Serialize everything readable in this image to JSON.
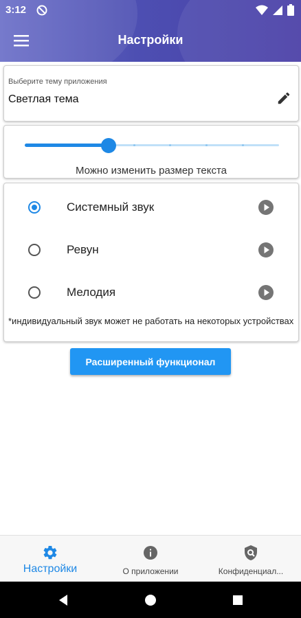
{
  "status_bar": {
    "time": "3:12"
  },
  "app_bar": {
    "title": "Настройки"
  },
  "theme": {
    "label": "Выберите тему приложения",
    "value": "Светлая тема"
  },
  "text_size": {
    "caption": "Можно изменить размер текста",
    "level_fraction": 0.33,
    "steps": 7
  },
  "sounds": {
    "items": [
      {
        "label": "Системный звук",
        "selected": true
      },
      {
        "label": "Ревун",
        "selected": false
      },
      {
        "label": "Мелодия",
        "selected": false
      }
    ],
    "note": "*индивидуальный звук может не работать на некоторых устройствах"
  },
  "advanced_button": {
    "label": "Расширенный функционал"
  },
  "bottom_nav": {
    "items": [
      {
        "label": "Настройки",
        "icon": "gear-icon",
        "active": true
      },
      {
        "label": "О приложении",
        "icon": "info-icon",
        "active": false
      },
      {
        "label": "Конфиденциал...",
        "icon": "privacy-shield-icon",
        "active": false
      }
    ]
  },
  "colors": {
    "accent": "#1e88e5",
    "header_start": "#6b6fc8",
    "header_end": "#4a3ea6",
    "button": "#2196f3"
  }
}
